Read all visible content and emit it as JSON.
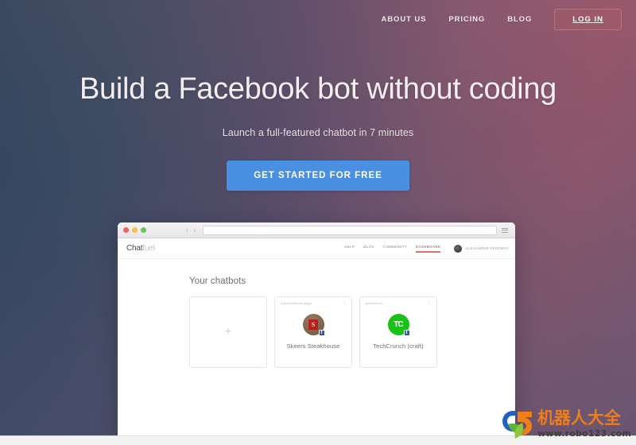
{
  "topnav": {
    "links": [
      {
        "label": "ABOUT US",
        "name": "nav-about-us"
      },
      {
        "label": "PRICING",
        "name": "nav-pricing"
      },
      {
        "label": "BLOG",
        "name": "nav-blog"
      }
    ],
    "login_label": "LOG IN"
  },
  "hero": {
    "title": "Build a Facebook bot without coding",
    "subtitle": "Launch a full-featured chatbot in 7 minutes",
    "cta_label": "GET STARTED FOR FREE",
    "cta_color": "#4a90e2",
    "bg_left_color": "#2e475e",
    "bg_right_color": "#a75c6d"
  },
  "browser": {
    "url_value": "",
    "url_placeholder": "",
    "back_glyph": "‹",
    "forward_glyph": "›"
  },
  "app": {
    "logo": {
      "part1": "Chat",
      "part2": "fuel"
    },
    "nav": [
      {
        "label": "HELP",
        "name": "app-nav-help",
        "active": false
      },
      {
        "label": "BLOG",
        "name": "app-nav-blog",
        "active": false
      },
      {
        "label": "COMMUNITY",
        "name": "app-nav-community",
        "active": false
      },
      {
        "label": "DASHBOARD",
        "name": "app-nav-dashboard",
        "active": true
      }
    ],
    "active_accent": "#d9725f",
    "user_name": "ALEXANDER FEDOROV",
    "dashboard": {
      "section_title": "Your chatbots",
      "add_card": {
        "glyph": "+",
        "label": ""
      },
      "cards": [
        {
          "status": "connected to page",
          "name": "Skeers Steakhouse",
          "avatar_initial": "S",
          "avatar_color": "#7d6149",
          "badge": "f",
          "menu_glyph": "⋮"
        },
        {
          "status": "published",
          "name": "TechCrunch (craft)",
          "avatar_initial": "TC",
          "avatar_color": "#17c416",
          "badge": "f",
          "menu_glyph": "⋮"
        }
      ]
    }
  },
  "watermark": {
    "cn_text": "机器人大全",
    "url_text": "www.robo123.com",
    "accent_color": "#ef7d1a"
  }
}
